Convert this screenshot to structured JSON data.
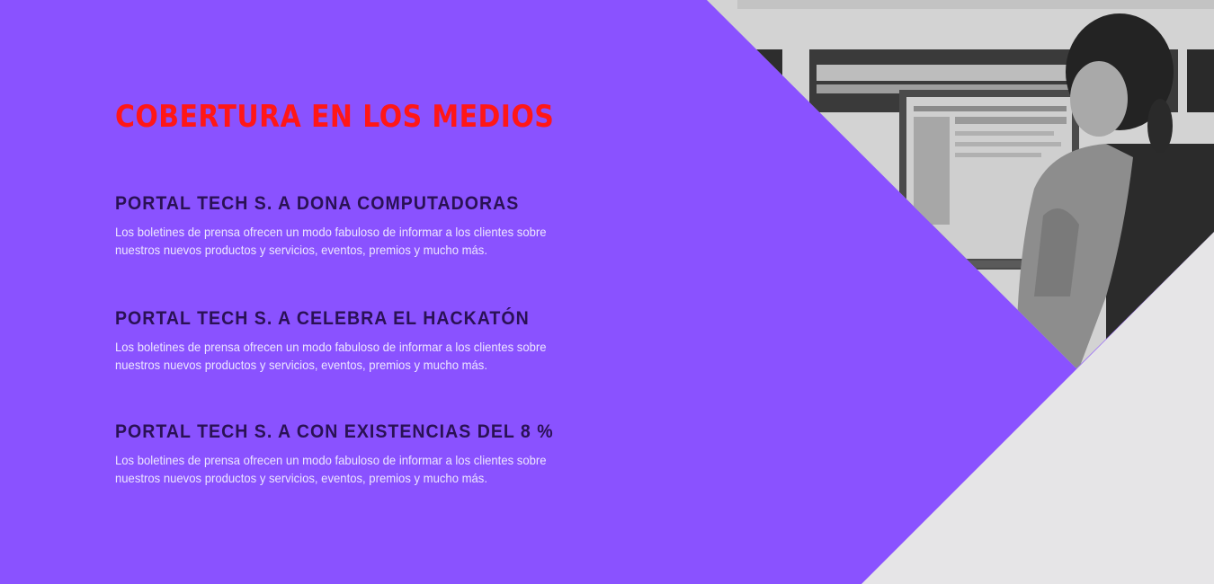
{
  "page": {
    "heading": "COBERTURA EN LOS MEDIOS",
    "colors": {
      "background": "#8a52ff",
      "heading": "#ff1717",
      "item_title": "#2a1155",
      "item_text": "#ece5ff",
      "corner_panel": "#e6e5e7"
    },
    "image": "photo-woman-at-computer-grayscale",
    "items": [
      {
        "title": "PORTAL TECH S. A DONA COMPUTADORAS",
        "description": "Los boletines de prensa ofrecen un modo fabuloso de informar a los clientes sobre nuestros nuevos productos y servicios, eventos, premios y mucho más."
      },
      {
        "title": "PORTAL TECH S. A CELEBRA EL HACKATÓN",
        "description": "Los boletines de prensa ofrecen un modo fabuloso de informar a los clientes sobre nuestros nuevos productos y servicios, eventos, premios y mucho más."
      },
      {
        "title": "PORTAL TECH S. A CON EXISTENCIAS DEL 8 %",
        "description": "Los boletines de prensa ofrecen un modo fabuloso de informar a los clientes sobre nuestros nuevos productos y servicios, eventos, premios y mucho más."
      }
    ]
  }
}
